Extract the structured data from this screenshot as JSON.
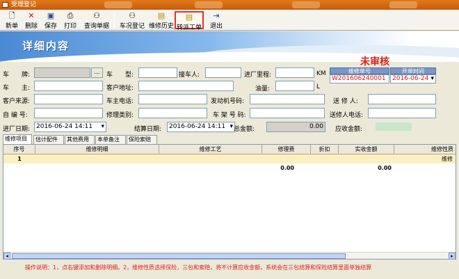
{
  "window": {
    "title": "受理登记"
  },
  "toolbar": {
    "new": "新单",
    "delete": "删除",
    "save": "保存",
    "print": "打印",
    "query": "查询单据",
    "vehicle_register": "车况登记",
    "repair_history": "维修历史",
    "to_work_order": "转派工单",
    "exit": "退出"
  },
  "banner": {
    "title": "详细内容"
  },
  "status": "未审核",
  "form": {
    "plate_label": "车　　牌:",
    "plate_btn": "...",
    "model_label": "车　　型:",
    "picker_label": "接车人:",
    "mileage_label": "进厂里程:",
    "mileage_unit": "KM",
    "owner_label": "车　　主:",
    "address_label": "客户地址:",
    "fuel_label": "油量:",
    "fuel_unit": "L",
    "source_label": "客户来源:",
    "owner_phone_label": "车主电话:",
    "engine_label": "发动机号码:",
    "sender_label": "送 修 人:",
    "code_label": "自 编 号:",
    "repair_type_label": "修理类别:",
    "frame_label": "车 架 号 码:",
    "sender_phone_label": "送修人电话:",
    "entry_date_label": "进厂日期:",
    "entry_date": "2016-06-24 14:11",
    "settle_date_label": "结算日期:",
    "settle_date": "2016-06-24 14:11",
    "total_label": "总金额:",
    "total": "0.00",
    "receivable_label": "应收金额:"
  },
  "order": {
    "no_header": "维修单号",
    "no": "W201606240001",
    "date_header": "开单时间",
    "date": "2016-06-24"
  },
  "tabs": [
    "维修项目",
    "估计配件",
    "其他费用",
    "本单备注",
    "保险索赔"
  ],
  "grid": {
    "headers": [
      "序号",
      "维修明细",
      "维修工艺",
      "修理费",
      "折扣",
      "实收金额",
      "维修性质"
    ],
    "rows": [
      {
        "no": "1",
        "nature": "维修"
      }
    ],
    "total_fee": "0.00",
    "total_amount": "0.00"
  },
  "note": "操作说明：1，点右键添加和删除明细。2，维修性质选择保险，三包和索赔，将不计算应收金额，系统会在三包结算和保险结算里面单独结算"
}
